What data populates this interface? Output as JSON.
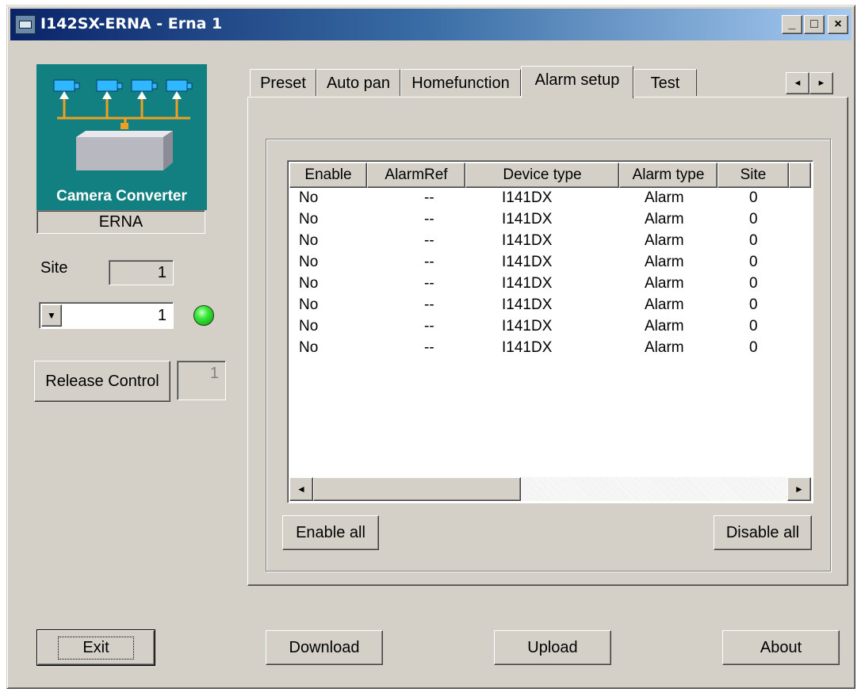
{
  "window": {
    "title": "I142SX-ERNA - Erna 1"
  },
  "titlebar_buttons": {
    "minimize": "_",
    "maximize": "□",
    "close": "×"
  },
  "left_panel": {
    "logo_caption": "Camera Converter",
    "device_name": "ERNA",
    "site_label": "Site",
    "site_value": "1",
    "site_selector_value": "1",
    "release_control_label": "Release Control",
    "release_control_value": "1",
    "status_led_color": "#3ce83c"
  },
  "tabs": [
    {
      "label": "Preset",
      "active": false
    },
    {
      "label": "Auto pan",
      "active": false
    },
    {
      "label": "Homefunction",
      "active": false
    },
    {
      "label": "Alarm setup",
      "active": true
    },
    {
      "label": "Test",
      "active": false
    }
  ],
  "tab_scroll": {
    "left": "◄",
    "right": "►"
  },
  "alarm_table": {
    "columns": [
      "Enable",
      "AlarmRef",
      "Device type",
      "Alarm type",
      "Site"
    ],
    "rows": [
      [
        "No",
        "--",
        "I141DX",
        "Alarm",
        "0"
      ],
      [
        "No",
        "--",
        "I141DX",
        "Alarm",
        "0"
      ],
      [
        "No",
        "--",
        "I141DX",
        "Alarm",
        "0"
      ],
      [
        "No",
        "--",
        "I141DX",
        "Alarm",
        "0"
      ],
      [
        "No",
        "--",
        "I141DX",
        "Alarm",
        "0"
      ],
      [
        "No",
        "--",
        "I141DX",
        "Alarm",
        "0"
      ],
      [
        "No",
        "--",
        "I141DX",
        "Alarm",
        "0"
      ],
      [
        "No",
        "--",
        "I141DX",
        "Alarm",
        "0"
      ]
    ]
  },
  "alarm_buttons": {
    "enable_all": "Enable all",
    "disable_all": "Disable all"
  },
  "bottom_buttons": {
    "exit": "Exit",
    "download": "Download",
    "upload": "Upload",
    "about": "About"
  }
}
